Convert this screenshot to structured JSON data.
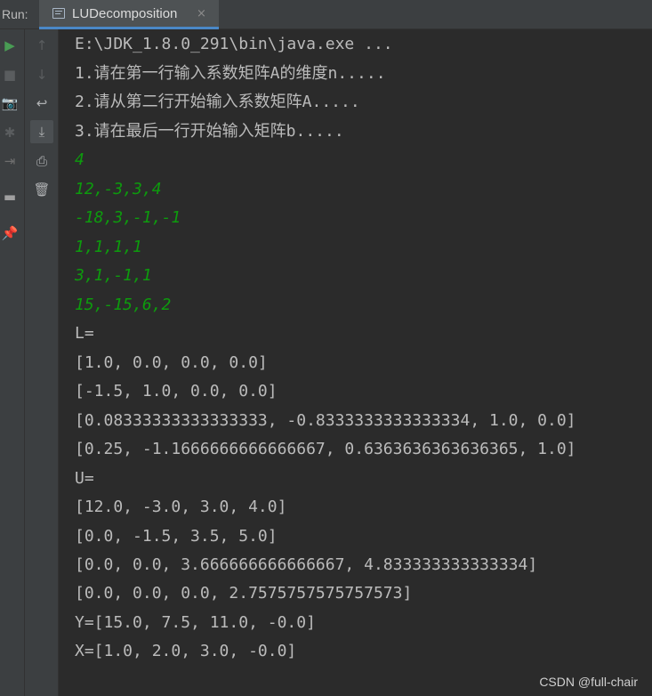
{
  "run_panel": {
    "label": "Run:",
    "tab": {
      "title": "LUDecomposition",
      "close": "×"
    }
  },
  "toolbar_left": [
    {
      "name": "run-icon",
      "glyph": "▶",
      "color": "#499c54"
    },
    {
      "name": "stop-icon",
      "glyph": "■",
      "color": "#5a5d5f"
    },
    {
      "name": "camera-icon",
      "glyph": "📷",
      "color": "#5a5d5f"
    },
    {
      "name": "debug-bug-icon",
      "glyph": "✱",
      "color": "#5a5d5f"
    },
    {
      "name": "exit-icon",
      "glyph": "⇥",
      "color": "#6e6e6e"
    },
    {
      "name": "layout-icon",
      "glyph": "▬",
      "color": "#a0a0a0"
    },
    {
      "name": "pin-icon",
      "glyph": "📌",
      "color": "#a0a0a0"
    }
  ],
  "toolbar_right": [
    {
      "name": "up-arrow-icon",
      "glyph": "↑",
      "color": "#5a5d5f"
    },
    {
      "name": "down-arrow-icon",
      "glyph": "↓",
      "color": "#5a5d5f"
    },
    {
      "name": "soft-wrap-icon",
      "glyph": "↩",
      "color": "#afb1b3"
    },
    {
      "name": "scroll-to-end-icon",
      "glyph": "⤓",
      "color": "#afb1b3"
    },
    {
      "name": "print-icon",
      "glyph": "⎙",
      "color": "#afb1b3"
    },
    {
      "name": "trash-icon",
      "glyph": "🗑",
      "color": "#afb1b3"
    }
  ],
  "console": {
    "command": "E:\\JDK_1.8.0_291\\bin\\java.exe ...",
    "prompts": [
      "1.请在第一行输入系数矩阵A的维度n.....",
      "2.请从第二行开始输入系数矩阵A.....",
      "3.请在最后一行开始输入矩阵b....."
    ],
    "inputs": [
      "4",
      "12,-3,3,4",
      "-18,3,-1,-1",
      "1,1,1,1",
      "3,1,-1,1",
      "15,-15,6,2"
    ],
    "output": [
      "L=",
      "[1.0, 0.0, 0.0, 0.0]",
      "[-1.5, 1.0, 0.0, 0.0]",
      "[0.08333333333333333, -0.8333333333333334, 1.0, 0.0]",
      "[0.25, -1.1666666666666667, 0.6363636363636365, 1.0]",
      "U=",
      "[12.0, -3.0, 3.0, 4.0]",
      "[0.0, -1.5, 3.5, 5.0]",
      "[0.0, 0.0, 3.666666666666667, 4.833333333333334]",
      "[0.0, 0.0, 0.0, 2.7575757575757573]",
      "Y=[15.0, 7.5, 11.0, -0.0]",
      "X=[1.0, 2.0, 3.0, -0.0]"
    ]
  },
  "watermark": "CSDN @full-chair",
  "colors": {
    "background": "#2b2b2b",
    "toolbar": "#3c3f41",
    "input_text": "#0d9b0d",
    "output_text": "#bbbbbb",
    "tab_underline": "#4a88c7"
  }
}
